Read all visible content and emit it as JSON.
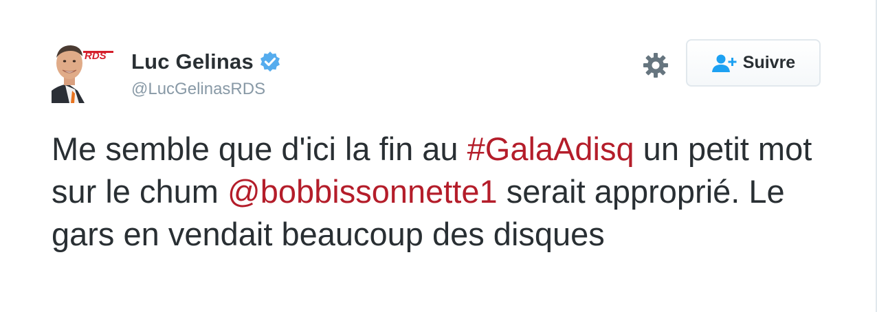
{
  "author": {
    "name": "Luc Gelinas",
    "handle": "@LucGelinasRDS",
    "verified": true,
    "avatar_icon": "profile-photo-icon",
    "avatar_logo_text": "RDS"
  },
  "actions": {
    "settings_icon": "gear-icon",
    "follow_icon": "add-user-icon",
    "follow_label": "Suivre"
  },
  "tweet": {
    "text_1": "Me semble que d'ici la fin au ",
    "hashtag": "#GalaAdisq",
    "text_2": " un petit mot sur le chum ",
    "mention": "@bobbissonnette1",
    "text_3": " serait approprié. Le gars en vendait beaucoup des disques"
  },
  "colors": {
    "link": "#b41d2a",
    "verified": "#55acee",
    "text": "#292f33",
    "muted": "#8899a6",
    "follow_icon": "#1da1f2"
  }
}
